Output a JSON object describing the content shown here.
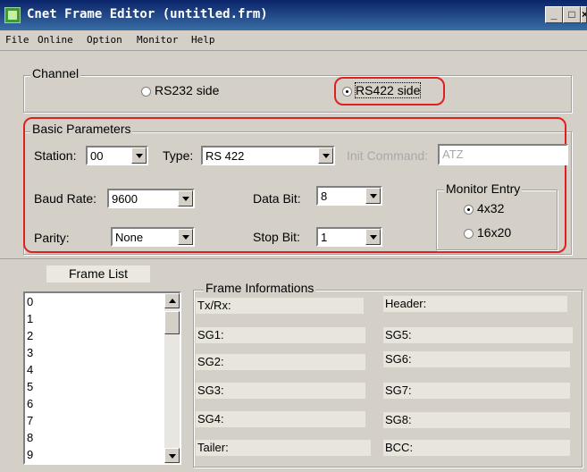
{
  "window": {
    "title": "Cnet Frame Editor (untitled.frm)"
  },
  "menu": [
    "File",
    "Online",
    "Option",
    "Monitor",
    "Help"
  ],
  "channel": {
    "legend": "Channel",
    "rs232_label": "RS232 side",
    "rs422_label": "RS422 side",
    "selected": "RS422 side"
  },
  "basic": {
    "legend": "Basic Parameters",
    "station_label": "Station:",
    "station_value": "00",
    "type_label": "Type:",
    "type_value": "RS 422",
    "init_label": "Init Command:",
    "init_value": "ATZ",
    "baud_label": "Baud Rate:",
    "baud_value": "9600",
    "databit_label": "Data Bit:",
    "databit_value": "8",
    "parity_label": "Parity:",
    "parity_value": "None",
    "stopbit_label": "Stop Bit:",
    "stopbit_value": "1"
  },
  "monitor": {
    "legend": "Monitor Entry",
    "opt1": "4x32",
    "opt2": "16x20",
    "selected": "4x32"
  },
  "frame_list": {
    "label": "Frame List",
    "items": [
      "0",
      "1",
      "2",
      "3",
      "4",
      "5",
      "6",
      "7",
      "8",
      "9"
    ]
  },
  "frame_info": {
    "legend": "Frame Informations",
    "txrx": "Tx/Rx:",
    "header": "Header:",
    "sg1": "SG1:",
    "sg2": "SG2:",
    "sg3": "SG3:",
    "sg4": "SG4:",
    "sg5": "SG5:",
    "sg6": "SG6:",
    "sg7": "SG7:",
    "sg8": "SG8:",
    "tailer": "Tailer:",
    "bcc": "BCC:"
  }
}
